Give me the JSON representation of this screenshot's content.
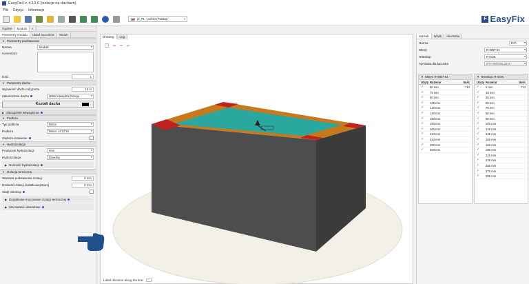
{
  "window": {
    "title": "EasyFix4 v. 4.10.6 (Izolacje na dachach)"
  },
  "menu": [
    "Plik",
    "Edycja",
    "Informacje"
  ],
  "toolbar": {
    "language": "pl_PL - polski (Polska)"
  },
  "logo": {
    "mark": "F",
    "text": "EasyFix"
  },
  "left": {
    "top_tabs": [
      "Ogólne",
      "Moduł1",
      "+"
    ],
    "sub_tabs": [
      "Parametry modułu",
      "Układ łączników",
      "Widok"
    ],
    "sections": {
      "basic": "Parametry podstawowe",
      "roof": "Parametry dachu",
      "wind": "Obciążenie wewnętrzne",
      "substrate": "Podłoże",
      "hydro": "Hydroizolacja",
      "thermal": "Izolacja termiczna"
    },
    "name_label": "Nazwa",
    "name_value": "Moduł0",
    "comment_label": "Komentarz",
    "count_label": "Ilość",
    "count_value": "1",
    "roof_height_label": "Wysokość dachu od gruntu",
    "roof_height_value": "10 m",
    "edge_label": "Zakończenie dachu",
    "edge_value": "Ostre krawędzie brzegu",
    "shape_button": "Kształt dachu",
    "substrate_type_label": "Typ podłoża",
    "substrate_type_value": "Beton",
    "substrate_label": "Podłoże",
    "substrate_value": "Beton, ≥C12/15",
    "anchor_depth_label": "Głębsze kotwienie",
    "hydro_producer_label": "Producent hydroizolacji",
    "hydro_producer_value": "Inne",
    "hydro_label": "Hydroizolacja",
    "hydro_value": "Dowolny",
    "hydro_strength_label": "Nośność hydroizolacji",
    "thermal_base_label": "Warstwa podstawowa izolacji",
    "thermal_base_value": "0 mm",
    "thermal_extra_label": "Grubość izolacji dodatkowej/starej",
    "thermal_extra_value": "0 mm",
    "fixed_tele_label": "Stały teleskop",
    "extra_fix_label": "Dodatkowe mocowanie izolacji termicznej",
    "perimeter_label": "Mocowanie obwodowe"
  },
  "drawing": {
    "tabs": [
      "Drawing",
      "Log"
    ],
    "axes": [
      "xy",
      "xz",
      "yz"
    ],
    "footer": "Label direction along the line:",
    "colors": {
      "roof_center": "#2aa8a0",
      "edge": "#c77a1d",
      "corner": "#c0221f",
      "box": "#5a5a5a",
      "floor": "#f3f0e7"
    }
  },
  "right": {
    "tabs": [
      "Łącznik",
      "Wynik",
      "Akcesoria"
    ],
    "norm_label": "Norma",
    "norm_value": "ETA",
    "anchor_label": "Wkręt",
    "anchor_value": "R-WBT-61",
    "tele_label": "Teleskop",
    "tele_value": "R-GOK",
    "approval_label": "Aprobata dla łącznika",
    "approval_value": "ETA-09/0346:2018",
    "table1": {
      "title": "Wkręt: R-WBT-61",
      "columns": [
        "Użyty",
        "Rozmiar",
        "Ilość"
      ],
      "rows": [
        [
          "✓",
          "50 mm",
          "714"
        ],
        [
          "✓",
          "75 mm",
          ""
        ],
        [
          "✓",
          "90 mm",
          ""
        ],
        [
          "✓",
          "100 mm",
          ""
        ],
        [
          "✓",
          "120 mm",
          ""
        ],
        [
          "✓",
          "140 mm",
          ""
        ],
        [
          "✓",
          "160 mm",
          ""
        ],
        [
          "✓",
          "180 mm",
          ""
        ],
        [
          "✓",
          "200 mm",
          ""
        ],
        [
          "✓",
          "220 mm",
          ""
        ],
        [
          "✓",
          "240 mm",
          ""
        ],
        [
          "✓",
          "260 mm",
          ""
        ],
        [
          "✓",
          "300 mm",
          ""
        ]
      ]
    },
    "table2": {
      "title": "Teleskop: R-GOK",
      "columns": [
        "Użyty",
        "Rozmiar",
        "Ilość"
      ],
      "rows": [
        [
          "✓",
          "0 mm",
          "714"
        ],
        [
          "✓",
          "15 mm",
          ""
        ],
        [
          "✓",
          "35 mm",
          ""
        ],
        [
          "✓",
          "65 mm",
          ""
        ],
        [
          "✓",
          "75 mm",
          ""
        ],
        [
          "✓",
          "85 mm",
          ""
        ],
        [
          "✓",
          "95 mm",
          ""
        ],
        [
          "✓",
          "105 mm",
          ""
        ],
        [
          "✓",
          "125 mm",
          ""
        ],
        [
          "✓",
          "135 mm",
          ""
        ],
        [
          "✓",
          "155 mm",
          ""
        ],
        [
          "✓",
          "165 mm",
          ""
        ],
        [
          "✓",
          "185 mm",
          ""
        ],
        [
          "✓",
          "225 mm",
          ""
        ],
        [
          "✓",
          "235 mm",
          ""
        ],
        [
          "✓",
          "255 mm",
          ""
        ],
        [
          "✓",
          "275 mm",
          ""
        ],
        [
          "✓",
          "295 mm",
          ""
        ]
      ]
    }
  }
}
